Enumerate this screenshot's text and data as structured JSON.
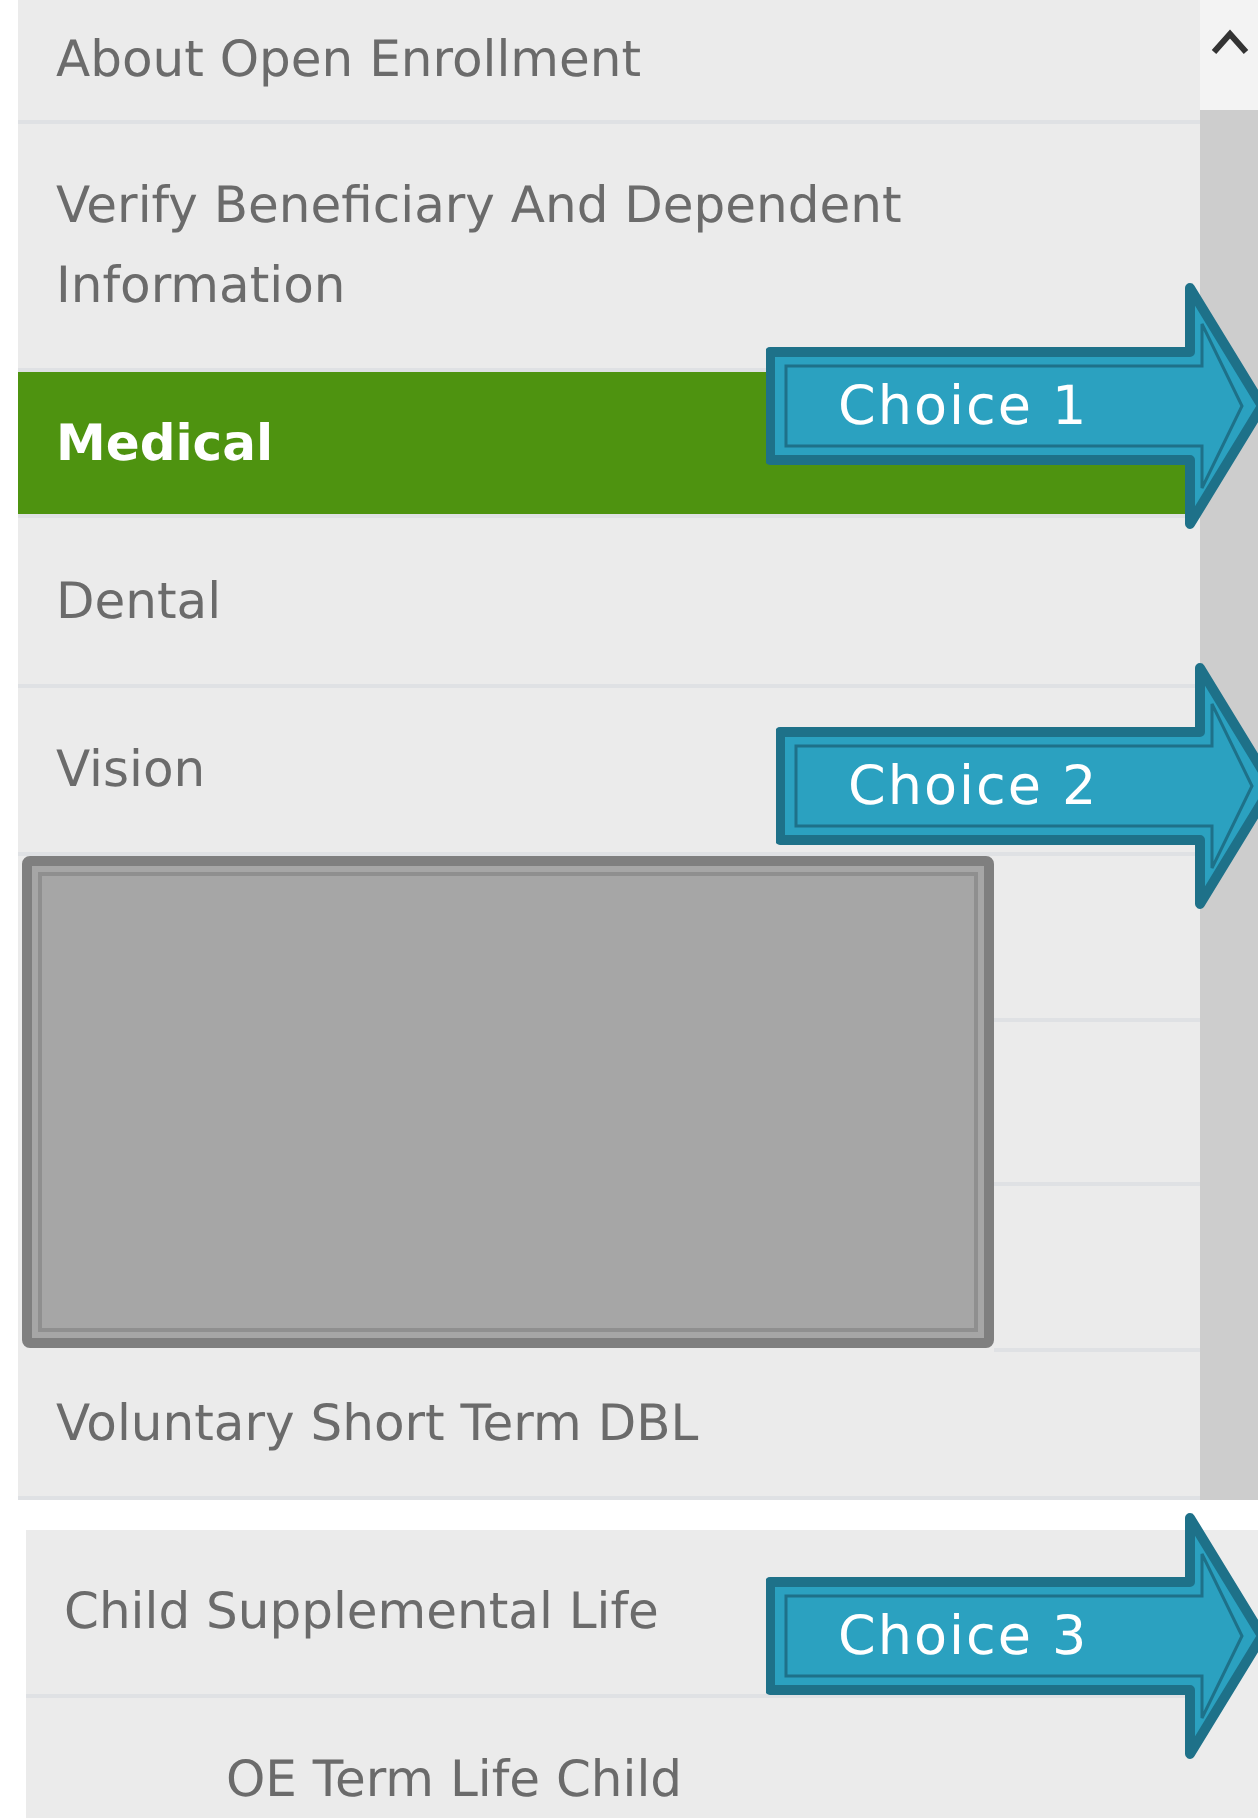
{
  "menu": [
    {
      "kind": "link",
      "label": "About Open Enrollment",
      "selected": false
    },
    {
      "kind": "link",
      "label": "Verify Beneficiary And Dependent Information",
      "selected": false
    },
    {
      "kind": "link",
      "label": "Medical",
      "selected": true
    },
    {
      "kind": "link",
      "label": "Dental",
      "selected": false
    },
    {
      "kind": "link",
      "label": "Vision",
      "selected": false
    },
    {
      "kind": "redacted"
    },
    {
      "kind": "link",
      "label": "Voluntary Short Term DBL",
      "selected": false
    }
  ],
  "menu_continued": [
    {
      "label": "Child Supplemental Life",
      "selected": false,
      "indented": false
    },
    {
      "label": "OE Term Life Child",
      "selected": false,
      "indented": true
    }
  ],
  "callouts": [
    {
      "label": "Choice 1"
    },
    {
      "label": "Choice 2"
    },
    {
      "label": "Choice 3"
    }
  ]
}
